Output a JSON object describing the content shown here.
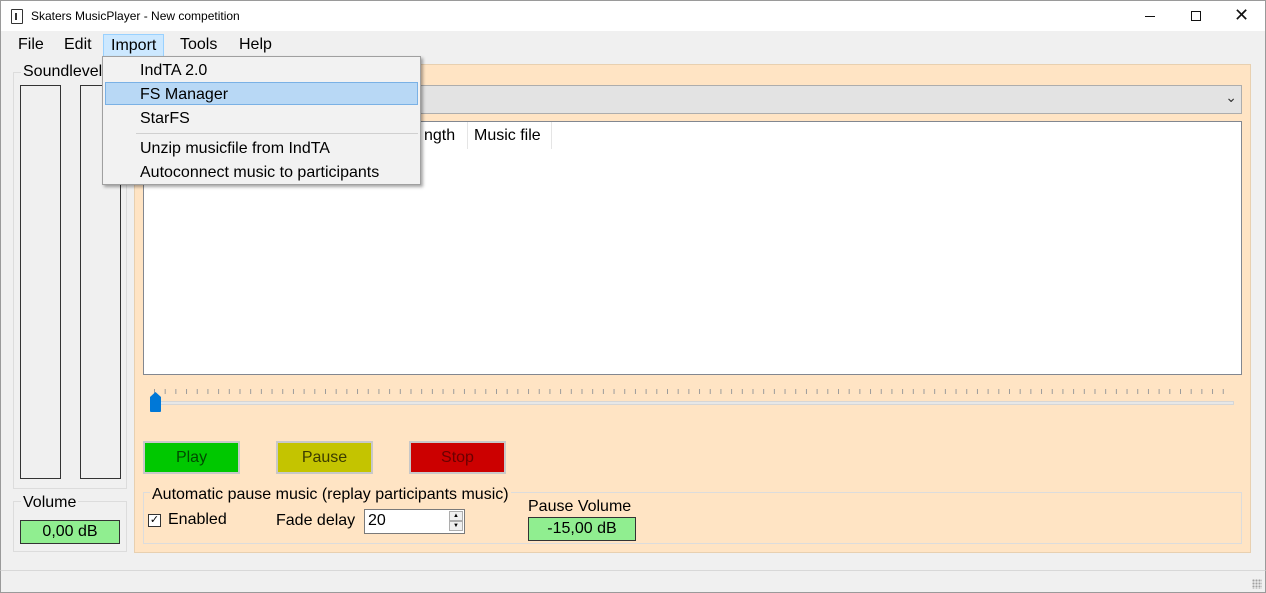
{
  "window": {
    "title": "Skaters MusicPlayer - New competition",
    "controls": [
      "minimize",
      "maximize",
      "close"
    ]
  },
  "menubar": {
    "items": [
      {
        "label": "File"
      },
      {
        "label": "Edit"
      },
      {
        "label": "Import",
        "active": true
      },
      {
        "label": "Tools"
      },
      {
        "label": "Help"
      }
    ]
  },
  "import_menu": {
    "items": [
      {
        "label": "IndTA 2.0"
      },
      {
        "label": "FS Manager",
        "highlighted": true
      },
      {
        "label": "StarFS"
      },
      {
        "label": "Unzip musicfile from IndTA"
      },
      {
        "label": "Autoconnect music to participants"
      }
    ]
  },
  "soundlevel": {
    "label": "Soundlevel"
  },
  "volume": {
    "label": "Volume",
    "value": "0,00 dB"
  },
  "music_list": {
    "columns": [
      "ngth",
      "Music file"
    ]
  },
  "playback": {
    "position": 0,
    "play_label": "Play",
    "pause_label": "Pause",
    "stop_label": "Stop"
  },
  "auto_pause": {
    "label": "Automatic pause music (replay participants music)",
    "enabled_label": "Enabled",
    "enabled": true,
    "fade_delay_label": "Fade delay",
    "fade_delay_value": "20",
    "pause_volume_label": "Pause Volume",
    "pause_volume_value": "-15,00 dB"
  },
  "colors": {
    "panel": "#ffe4c4",
    "db_box": "#90ee90",
    "play": "#00c800",
    "pause": "#c4c400",
    "stop": "#cc0000",
    "menu_highlight": "#b8d8f5"
  }
}
